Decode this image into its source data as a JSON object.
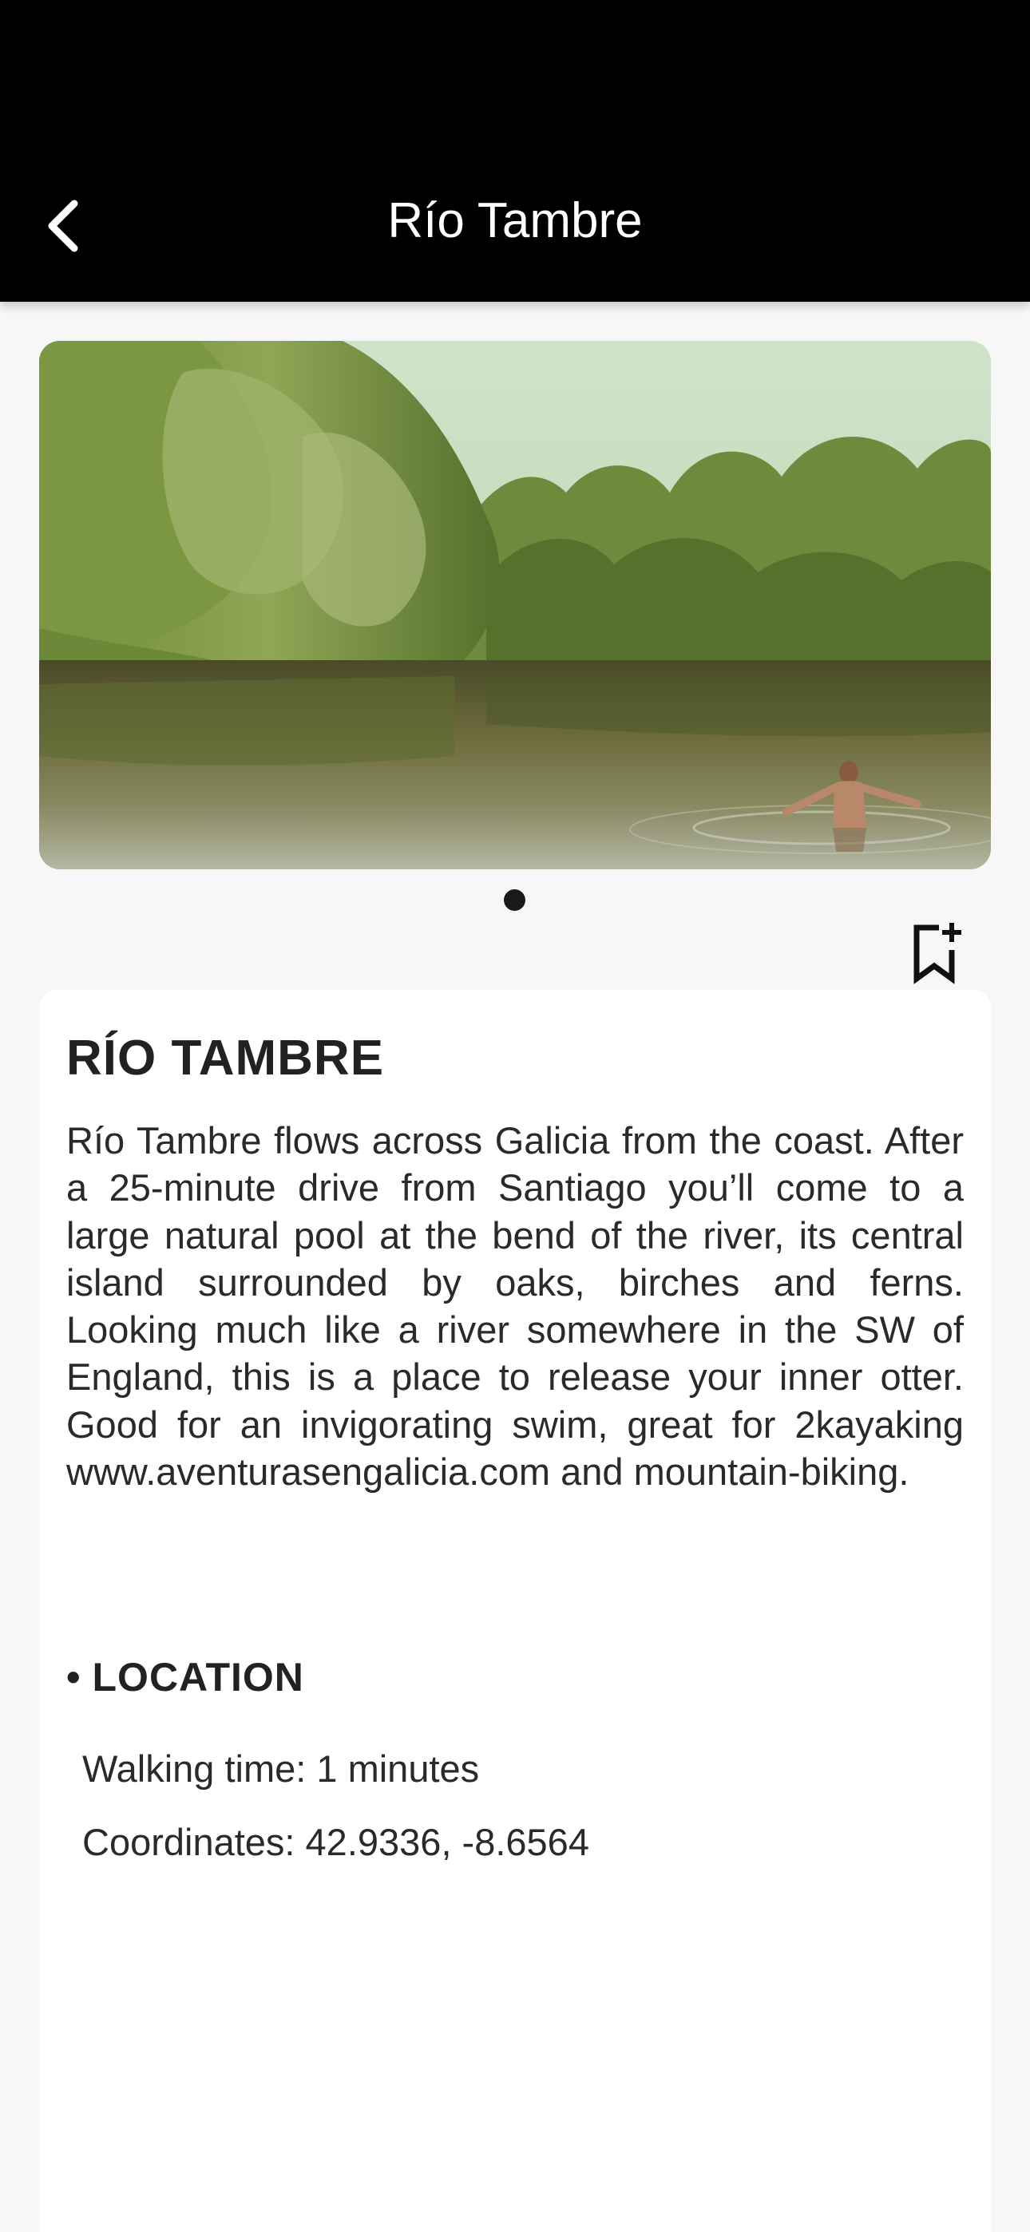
{
  "header": {
    "title": "Río Tambre",
    "back_icon": "chevron-left-icon"
  },
  "gallery": {
    "image_alt": "River with trees and a swimmer",
    "page_count": 1,
    "current_page": 1
  },
  "actions": {
    "bookmark_icon": "bookmark-add-icon"
  },
  "place": {
    "title": "RÍO TAMBRE",
    "description": "Río Tambre flows across Galicia from the coast. After a 25-minute drive from Santiago you’ll come to a large natural pool at the bend of the river, its central island surrounded by oaks, birches and ferns. Looking much like a river somewhere in the SW of England, this is a place to release your inner otter.  Good for an invigorating swim, great for 2kayaking www.aventurasengalicia.com and mountain-biking."
  },
  "location": {
    "bullet": "•",
    "heading": "LOCATION",
    "walking_time": "Walking time: 1 minutes",
    "coordinates": "Coordinates: 42.9336, -8.6564"
  },
  "colors": {
    "header_bg": "#000000",
    "page_bg": "#f7f7f7",
    "card_bg": "#ffffff",
    "text": "#222222"
  }
}
